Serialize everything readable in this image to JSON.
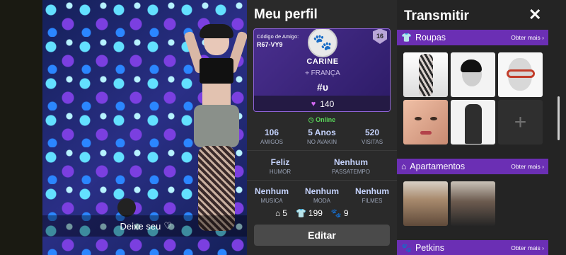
{
  "scene": {
    "leave_label": "Deixe seu",
    "leave_icon": "heart-outline-icon"
  },
  "profile": {
    "title": "Meu perfil",
    "friend_code_label": "Código de Amigo:",
    "friend_code": "R67-VY9",
    "level": "16",
    "name": "CARINE",
    "location": "FRANÇA",
    "tag": "#υ",
    "hearts": "140",
    "status": "Online",
    "stats": [
      {
        "value": "106",
        "label": "AMIGOS"
      },
      {
        "value": "5 Anos",
        "label": "NO AVAKIN"
      },
      {
        "value": "520",
        "label": "VISITAS"
      }
    ],
    "mood": {
      "value": "Feliz",
      "label": "HUMOR"
    },
    "hobby": {
      "value": "Nenhum",
      "label": "PASSATEMPO"
    },
    "prefs": [
      {
        "value": "Nenhum",
        "label": "MUSICA"
      },
      {
        "value": "Nenhum",
        "label": "MODA"
      },
      {
        "value": "Nenhum",
        "label": "FILMES"
      }
    ],
    "counts": {
      "homes": "5",
      "outfits": "199",
      "pets": "9"
    },
    "edit_label": "Editar"
  },
  "right": {
    "title": "Transmitir",
    "close_icon": "close-icon",
    "sections": [
      {
        "name": "Roupas",
        "more": "Obter mais",
        "icon": "shirt-icon"
      },
      {
        "name": "Apartamentos",
        "more": "Obter mais",
        "icon": "house-icon"
      },
      {
        "name": "Petkins",
        "more": "Obter mais",
        "icon": "paw-icon"
      }
    ],
    "add_tile": "+"
  },
  "colors": {
    "accent_purple": "#6b2fb4",
    "online_green": "#59d65a",
    "card_border": "#8e63d6"
  }
}
